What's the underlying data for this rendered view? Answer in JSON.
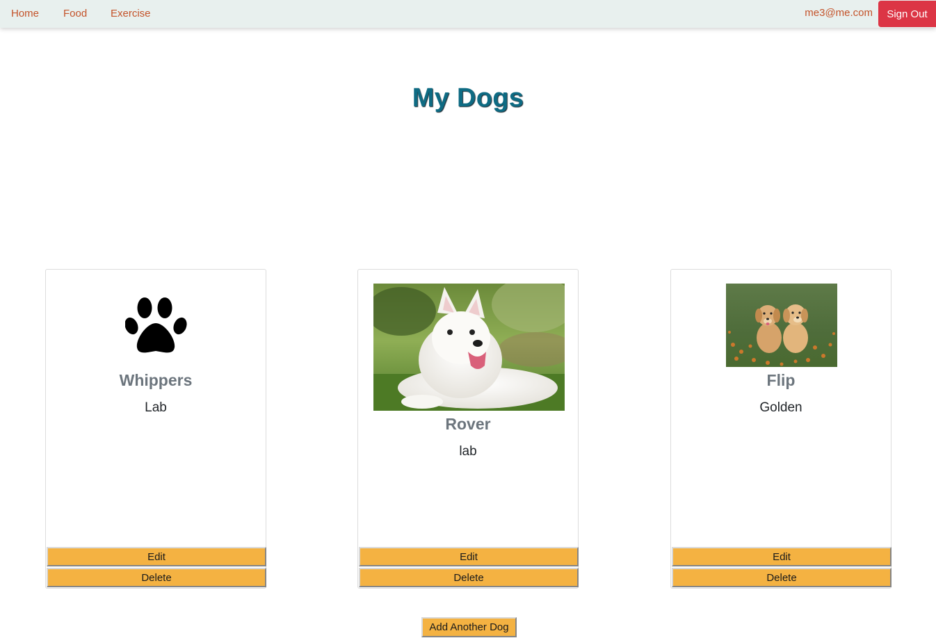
{
  "nav": {
    "home": "Home",
    "food": "Food",
    "exercise": "Exercise",
    "user_email": "me3@me.com",
    "sign_out": "Sign Out"
  },
  "page": {
    "title": "My Dogs",
    "add_button": "Add Another Dog"
  },
  "dogs": [
    {
      "name": "Whippers",
      "breed": "Lab",
      "image": "paw-icon",
      "edit": "Edit",
      "delete": "Delete"
    },
    {
      "name": "Rover",
      "breed": "lab",
      "image": "white-dog-photo",
      "edit": "Edit",
      "delete": "Delete"
    },
    {
      "name": "Flip",
      "breed": "Golden",
      "image": "golden-puppies-photo",
      "edit": "Edit",
      "delete": "Delete"
    }
  ],
  "colors": {
    "nav_bg": "#e8f0ee",
    "nav_link": "#c4532a",
    "sign_out_bg": "#dc3545",
    "title": "#0e6b83",
    "button_bg": "#f4b242"
  }
}
